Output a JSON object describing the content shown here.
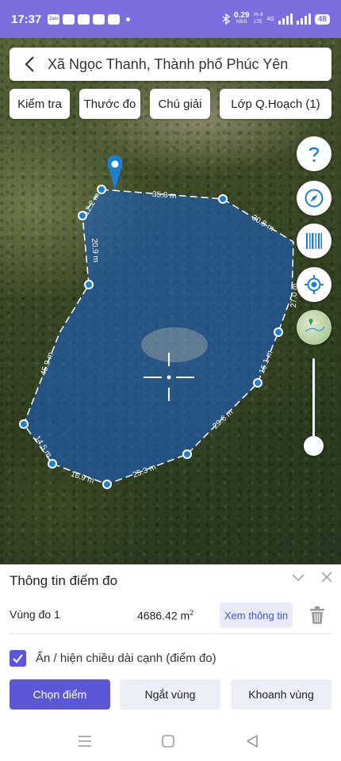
{
  "status_bar": {
    "time": "17:37",
    "net_speed": "0.29",
    "net_unit": "KB/S",
    "network_type": "Vo 8",
    "lte_label": "LTE",
    "signal_label": "4G",
    "battery": "48"
  },
  "header": {
    "title": "Xã Ngọc Thanh, Thành phố Phúc Yên"
  },
  "toolbar": {
    "check_label": "Kiểm tra",
    "measure_label": "Thước đo",
    "legend_label": "Chú giải",
    "layer_label": "Lớp Q.Hoạch (1)"
  },
  "map": {
    "edge_labels": [
      "35.8 m",
      "30.8 m",
      "27.0 m",
      "16.1 m",
      "29.6 m",
      "25.3 m",
      "16.9 m",
      "14.5 m",
      "45.9 m",
      "20.9 m",
      "12.2 m"
    ],
    "polygon_fill": "#1d5fbf",
    "accent": "#1c7fd6"
  },
  "panel": {
    "title": "Thông tin điểm đo",
    "zone_name": "Vùng đo 1",
    "zone_area": "4686.42 m",
    "area_unit_exp": "2",
    "view_info_label": "Xem thông tin",
    "toggle_edges_label": "Ẩn / hiện chiều dài cạnh (điểm đo)",
    "toggle_edges_checked": true,
    "buttons": {
      "pick_point": "Chọn điểm",
      "break_zone": "Ngắt vùng",
      "close_zone": "Khoanh vùng"
    }
  },
  "colors": {
    "primary": "#5b57d6",
    "statusbar": "#7b6fe0",
    "secondary_button": "#eceef8"
  },
  "icons": {
    "back": "chevron-left-icon",
    "help": "question-icon",
    "compass": "compass-icon",
    "barcode": "barcode-icon",
    "locate": "gps-locate-icon",
    "layers": "map-layer-icon",
    "collapse": "chevron-down-icon",
    "close": "close-icon",
    "trash": "trash-icon",
    "check": "check-icon"
  }
}
